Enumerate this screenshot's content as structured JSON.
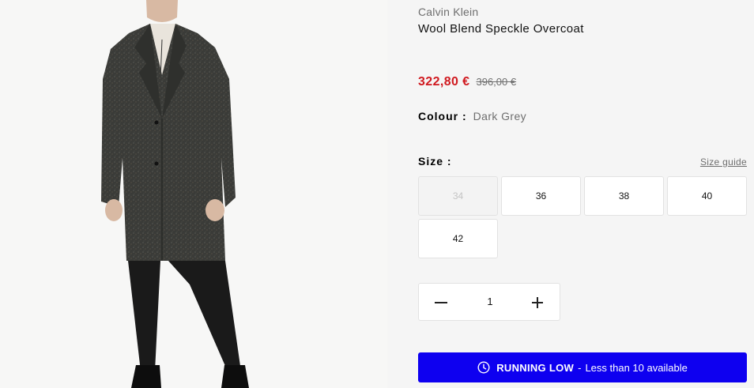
{
  "product": {
    "brand": "Calvin Klein",
    "name": "Wool Blend Speckle Overcoat",
    "image_icon": "product-photo-icon"
  },
  "pricing": {
    "sale_price": "322,80 €",
    "original_price": "396,00 €",
    "sale_color": "#d0191f"
  },
  "colour": {
    "label": "Colour :",
    "value": "Dark Grey"
  },
  "size": {
    "label": "Size :",
    "guide_link": "Size guide",
    "options": [
      {
        "label": "34",
        "available": false
      },
      {
        "label": "36",
        "available": true
      },
      {
        "label": "38",
        "available": true
      },
      {
        "label": "40",
        "available": true
      },
      {
        "label": "42",
        "available": true
      }
    ]
  },
  "quantity": {
    "value": "1",
    "minus_icon": "minus-icon",
    "plus_icon": "plus-icon"
  },
  "stock_alert": {
    "icon": "clock-icon",
    "title": "RUNNING LOW",
    "separator": "-",
    "text": "Less than 10 available",
    "color": "#0e00f0"
  }
}
